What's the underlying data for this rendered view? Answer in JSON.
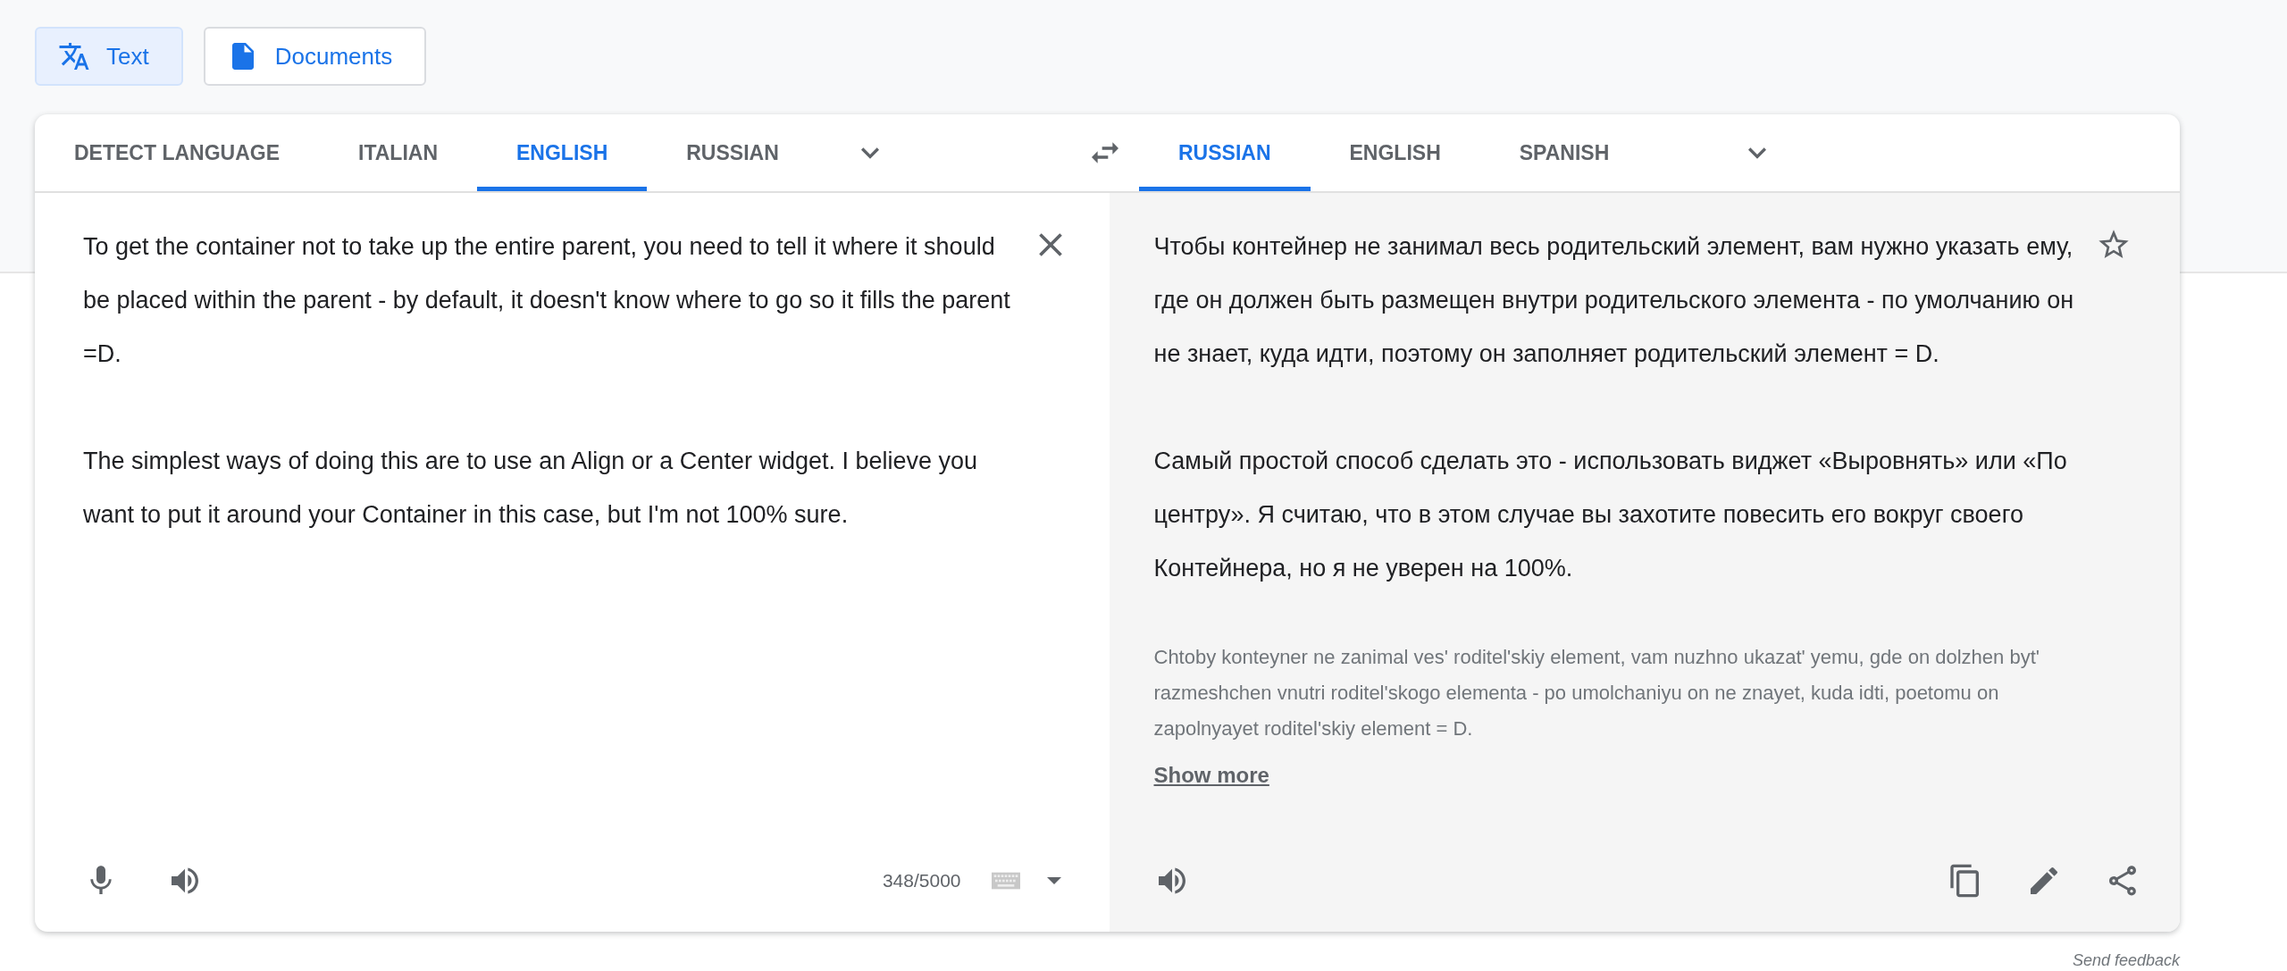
{
  "mode_tabs": [
    {
      "kind": "text",
      "label": "Text",
      "selected": true
    },
    {
      "kind": "documents",
      "label": "Documents",
      "selected": false
    }
  ],
  "source": {
    "languages": [
      {
        "label": "DETECT LANGUAGE",
        "selected": false
      },
      {
        "label": "ITALIAN",
        "selected": false
      },
      {
        "label": "ENGLISH",
        "selected": true
      },
      {
        "label": "RUSSIAN",
        "selected": false
      }
    ],
    "paragraphs": [
      "To get the container not to take up the entire parent, you need to tell it where it should be placed within the parent - by default, it doesn't know where to go so it fills the parent =D.",
      "The simplest ways of doing this are to use an Align or a Center widget. I believe you want to put it around your Container in this case, but I'm not 100% sure."
    ],
    "char_count": "348/5000"
  },
  "target": {
    "languages": [
      {
        "label": "RUSSIAN",
        "selected": true
      },
      {
        "label": "ENGLISH",
        "selected": false
      },
      {
        "label": "SPANISH",
        "selected": false
      }
    ],
    "paragraphs": [
      "Чтобы контейнер не занимал весь родительский элемент, вам нужно указать ему, где он должен быть размещен внутри родительского элемента - по умолчанию он не знает, куда идти, поэтому он заполняет родительский элемент = D.",
      "Самый простой способ сделать это - использовать виджет «Выровнять» или «По центру». Я считаю, что в этом случае вы захотите повесить его вокруг своего Контейнера, но я не уверен на 100%."
    ],
    "transliteration": "Chtoby konteyner ne zanimal ves' roditel'skiy element, vam nuzhno ukazat' yemu, gde on dolzhen byt' razmeshchen vnutri roditel'skogo elementa - po umolchaniyu on ne znayet, kuda idti, poetomu on zapolnyayet roditel'skiy element = D.",
    "show_more": "Show more"
  },
  "send_feedback": "Send feedback"
}
